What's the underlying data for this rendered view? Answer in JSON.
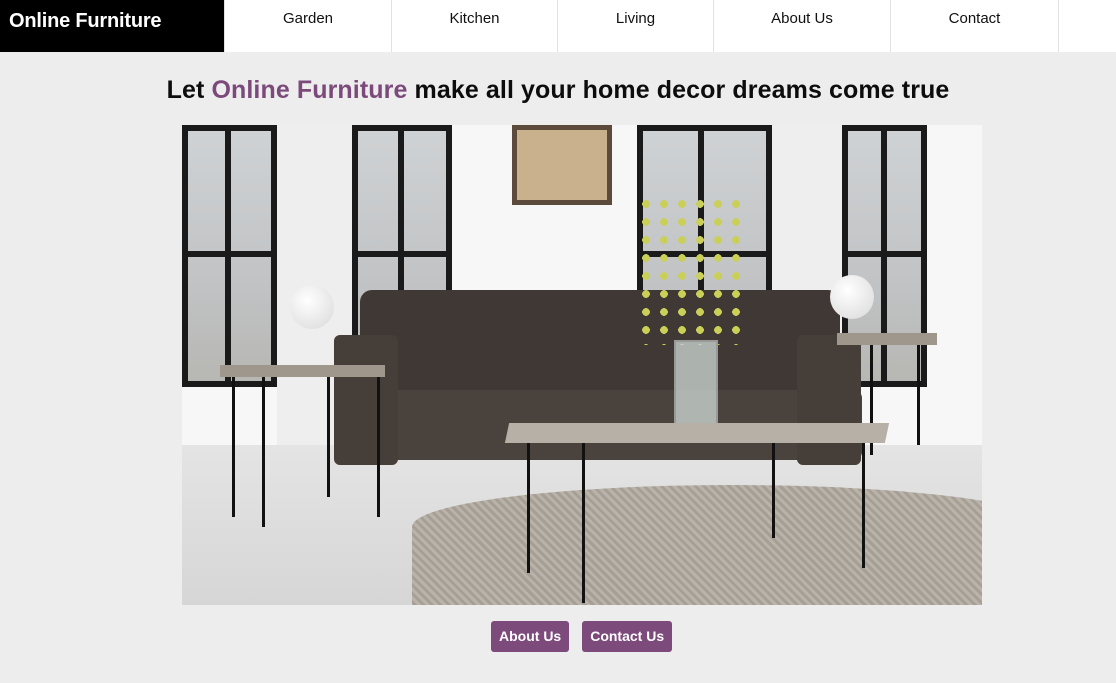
{
  "header": {
    "brand": "Online Furniture",
    "nav": [
      "Garden",
      "Kitchen",
      "Living",
      "About Us",
      "Contact"
    ]
  },
  "hero": {
    "headline_prefix": "Let ",
    "headline_accent": "Online Furniture",
    "headline_suffix": " make all your home decor dreams come true",
    "image_alt": "Living room with sofa, coffee table and side tables"
  },
  "actions": {
    "about_label": "About Us",
    "contact_label": "Contact Us"
  },
  "colors": {
    "accent": "#7b4a7b",
    "page_background": "#ededed",
    "brand_background": "#000000"
  }
}
